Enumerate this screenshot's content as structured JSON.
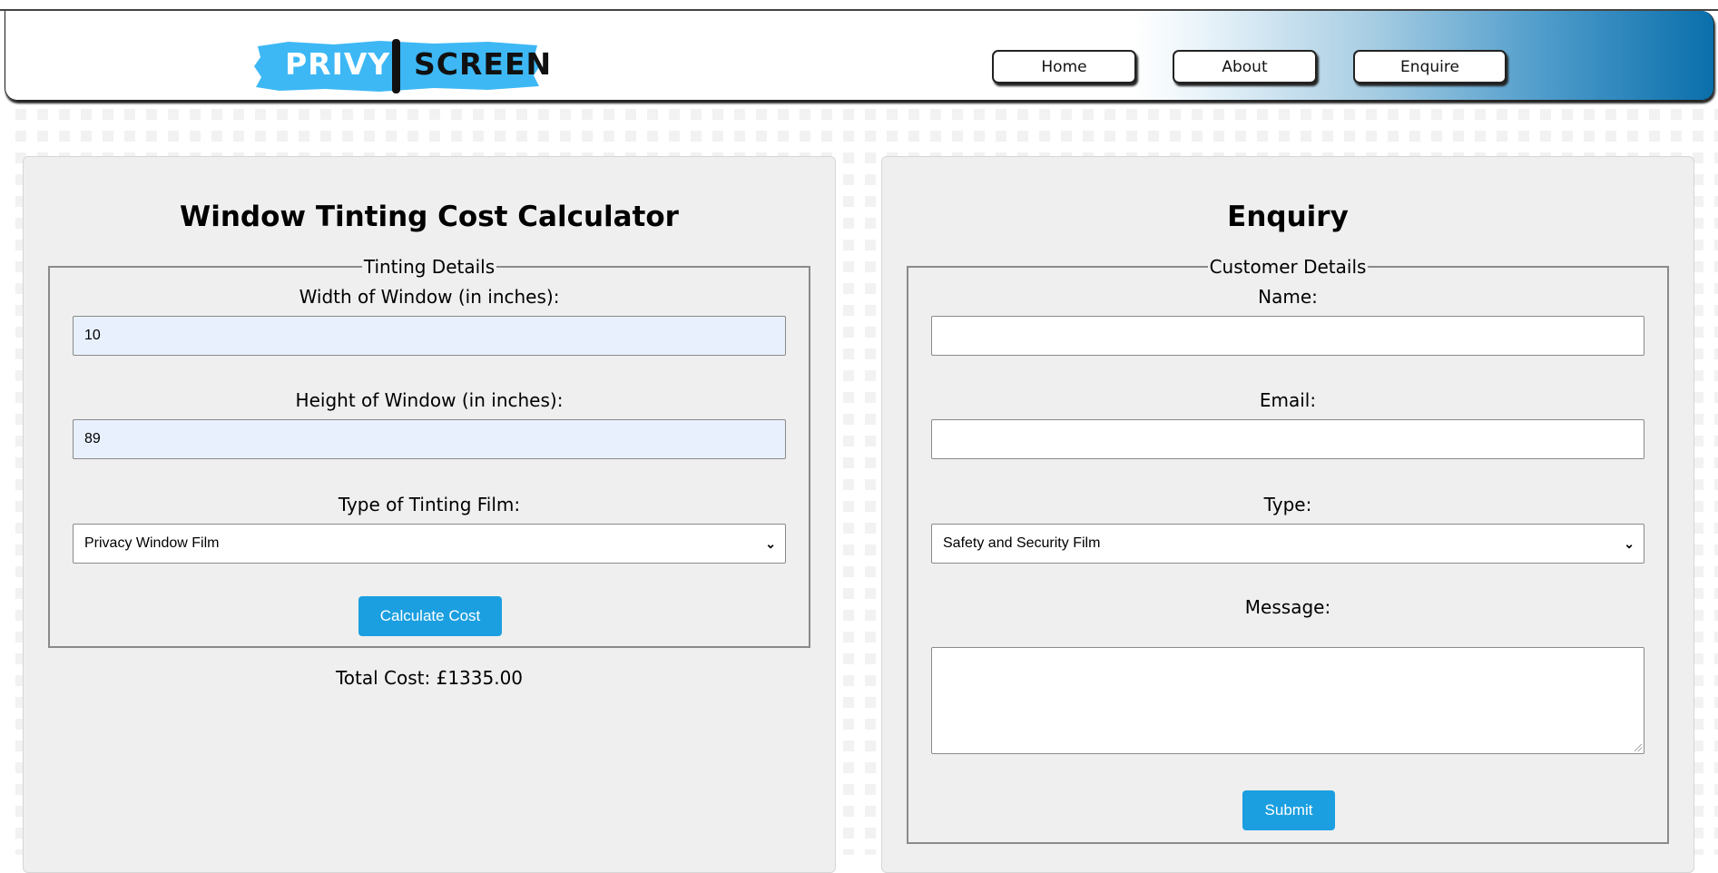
{
  "logo": {
    "left_text": "PRIVY",
    "right_text": "SCREEN",
    "accent": "#3db8f5"
  },
  "nav": {
    "items": [
      {
        "label": "Home"
      },
      {
        "label": "About"
      },
      {
        "label": "Enquire"
      }
    ]
  },
  "calculator": {
    "title": "Window Tinting Cost Calculator",
    "legend": "Tinting Details",
    "width_label": "Width of Window (in inches):",
    "width_value": "10",
    "height_label": "Height of Window (in inches):",
    "height_value": "89",
    "type_label": "Type of Tinting Film:",
    "type_value": "Privacy Window Film",
    "button_label": "Calculate Cost",
    "total_text": "Total Cost: £1335.00"
  },
  "enquiry": {
    "title": "Enquiry",
    "legend": "Customer Details",
    "name_label": "Name:",
    "name_value": "",
    "email_label": "Email:",
    "email_value": "",
    "type_label": "Type:",
    "type_value": "Safety and Security Film",
    "message_label": "Message:",
    "message_value": "",
    "submit_label": "Submit"
  },
  "colors": {
    "button": "#1b9fe0",
    "header_gradient_end": "#0a6fab",
    "panel": "#efefef",
    "autofill": "#e8f0fe"
  },
  "icons": {
    "select_arrow": "chevron-down-icon"
  }
}
